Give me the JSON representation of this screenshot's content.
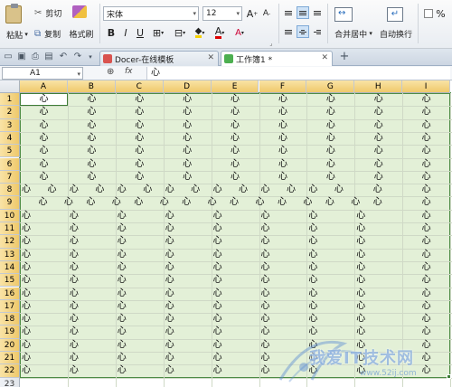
{
  "ribbon": {
    "paste_label": "粘贴",
    "cut_label": "剪切",
    "copy_label": "复制",
    "format_painter_label": "格式刷",
    "font_name": "宋体",
    "font_size": "12",
    "merge_center_label": "合并居中",
    "wrap_text_label": "自动换行",
    "percent_symbol": "%",
    "grow_font": "A",
    "shrink_font": "A",
    "bold": "B",
    "italic": "I",
    "underline": "U",
    "font_color_glyph": "A"
  },
  "tabs": [
    {
      "label": "Docer-在线模板",
      "icon": "docer-icon",
      "icon_color": "#d9534f",
      "active": false
    },
    {
      "label": "工作簿1 *",
      "icon": "spreadsheet-icon",
      "icon_color": "#4caf50",
      "active": true
    }
  ],
  "tab_new": "+",
  "formula_bar": {
    "name_box": "A1",
    "fx_label": "fx",
    "value": "心"
  },
  "sheet": {
    "columns": [
      "A",
      "B",
      "C",
      "D",
      "E",
      "F",
      "G",
      "H",
      "I"
    ],
    "rows": [
      "1",
      "2",
      "3",
      "4",
      "5",
      "6",
      "7",
      "8",
      "9",
      "10",
      "11",
      "12",
      "13",
      "14",
      "15",
      "16",
      "17",
      "18",
      "19",
      "20",
      "21",
      "22",
      "23"
    ],
    "cell_text": "心",
    "selection_fill": "#e3f0d7",
    "selection_border": "#4d8b45"
  },
  "watermark": {
    "text": "我爱IT技术网",
    "url": "www.52ij.com"
  }
}
